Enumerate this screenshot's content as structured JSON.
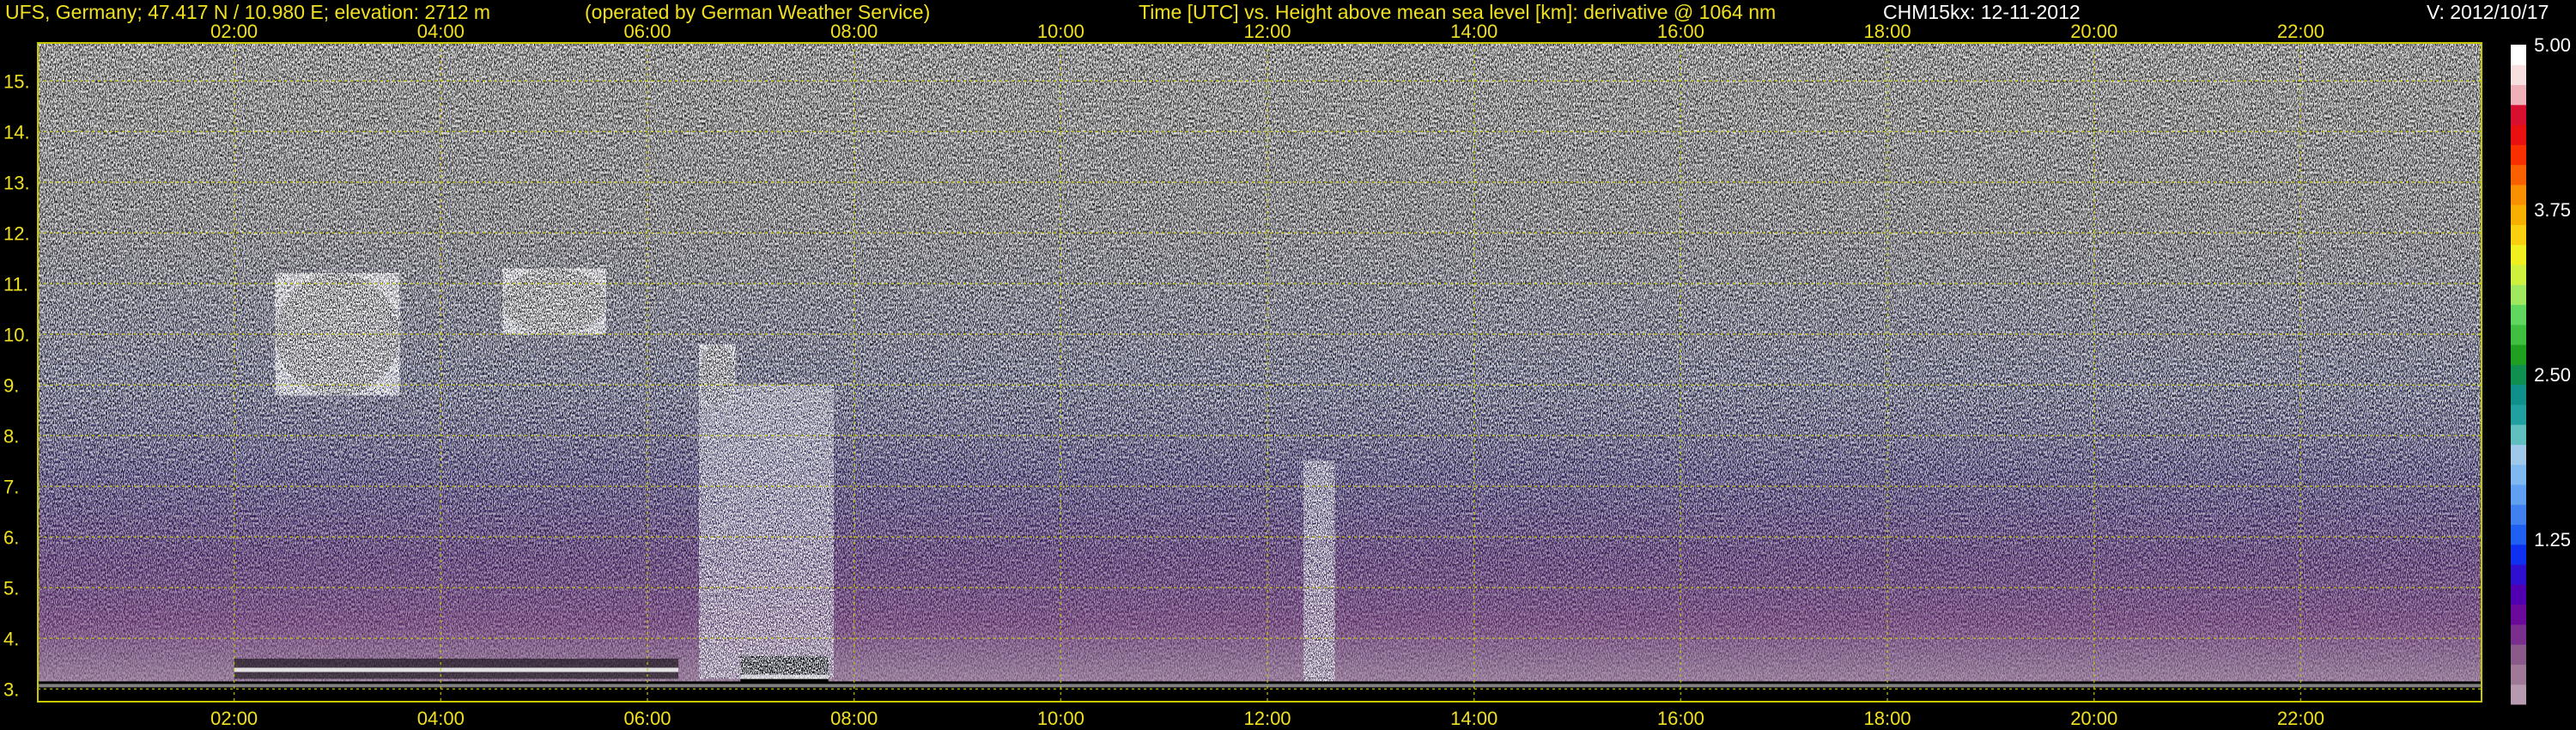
{
  "header": {
    "station": "UFS, Germany; 47.417 N / 10.980 E; elevation: 2712 m",
    "operator": "(operated by German Weather Service)",
    "title": "Time [UTC] vs. Height above mean sea level [km]: derivative @ 1064 nm",
    "instrument": "CHM15kx: 12-11-2012",
    "version": "V: 2012/10/17"
  },
  "colors": {
    "text_yellow": "#f0e020",
    "text_white": "#ffffff",
    "grid": "#c8c800",
    "background": "#000000"
  },
  "chart_data": {
    "type": "heatmap",
    "title": "Time [UTC] vs. Height above mean sea level [km]: derivative @ 1064 nm",
    "xlabel": "Time [UTC]",
    "ylabel": "Height above mean sea level [km]",
    "x_unit": "hours UTC",
    "xlim": [
      0.1,
      23.75
    ],
    "ylim": [
      2.75,
      15.75
    ],
    "x_ticks": [
      2,
      4,
      6,
      8,
      10,
      12,
      14,
      16,
      18,
      20,
      22
    ],
    "x_tick_labels": [
      "02:00",
      "04:00",
      "06:00",
      "08:00",
      "10:00",
      "12:00",
      "14:00",
      "16:00",
      "18:00",
      "20:00",
      "22:00"
    ],
    "y_ticks": [
      3,
      4,
      5,
      6,
      7,
      8,
      9,
      10,
      11,
      12,
      13,
      14,
      15
    ],
    "y_tick_labels": [
      "3.",
      "4.",
      "5.",
      "6.",
      "7.",
      "8.",
      "9.",
      "10.",
      "11.",
      "12.",
      "13.",
      "14.",
      "15."
    ],
    "grid": true,
    "colorbar": {
      "range": [
        0,
        5
      ],
      "tick_values": [
        1.25,
        2.5,
        3.75,
        5.0
      ],
      "tick_labels": [
        "1.25",
        "2.50",
        "3.75",
        "5.00"
      ],
      "colors": [
        "#b89ab0",
        "#a07898",
        "#8a5a8a",
        "#7a2e8e",
        "#6a0a9a",
        "#5000b0",
        "#3010d0",
        "#1030f0",
        "#2060f0",
        "#4080f0",
        "#60a0f0",
        "#80b8f0",
        "#a0c8e8",
        "#60c0c0",
        "#20a0a0",
        "#10908a",
        "#109050",
        "#20a020",
        "#40c040",
        "#60d860",
        "#a0e860",
        "#d0f040",
        "#f0f020",
        "#f8d010",
        "#f8b000",
        "#f89000",
        "#f86000",
        "#f83000",
        "#e81010",
        "#d81030",
        "#f0b0b8",
        "#f8e0e0",
        "#ffffff"
      ]
    },
    "features": [
      {
        "name": "cloud",
        "time_range": [
          2.4,
          3.6
        ],
        "height_range": [
          8.8,
          11.2
        ]
      },
      {
        "name": "cloud",
        "time_range": [
          4.6,
          5.6
        ],
        "height_range": [
          10.0,
          11.3
        ]
      },
      {
        "name": "cloud",
        "time_range": [
          6.5,
          6.85
        ],
        "height_range": [
          8.6,
          9.8
        ]
      },
      {
        "name": "low cloud layer",
        "time_range": [
          6.9,
          7.75
        ],
        "height_range": [
          3.05,
          3.65
        ]
      },
      {
        "name": "precipitation streak",
        "time_range": [
          6.5,
          7.8
        ],
        "height_range": [
          3.2,
          9.0
        ]
      },
      {
        "name": "precipitation streak",
        "time_range": [
          12.35,
          12.65
        ],
        "height_range": [
          3.0,
          7.5
        ]
      },
      {
        "name": "boundary layer top",
        "time_range": [
          2.0,
          6.3
        ],
        "height_range": [
          3.2,
          3.6
        ]
      }
    ]
  }
}
